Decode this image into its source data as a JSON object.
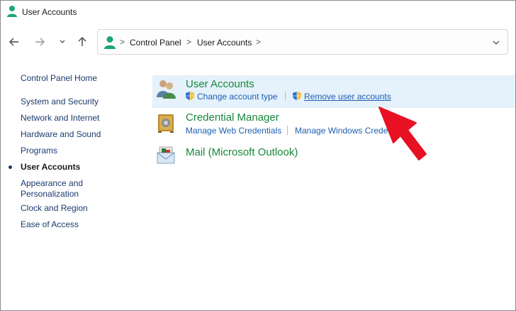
{
  "window": {
    "title": "User Accounts"
  },
  "address": {
    "crumbs": [
      "Control Panel",
      "User Accounts"
    ],
    "separator": ">"
  },
  "sidebar": {
    "home": "Control Panel Home",
    "items": [
      {
        "label": "System and Security"
      },
      {
        "label": "Network and Internet"
      },
      {
        "label": "Hardware and Sound"
      },
      {
        "label": "Programs"
      },
      {
        "label": "User Accounts",
        "active": true
      },
      {
        "label": "Appearance and"
      },
      {
        "label": "Personalization"
      },
      {
        "label": "Clock and Region"
      },
      {
        "label": "Ease of Access"
      }
    ]
  },
  "categories": [
    {
      "title": "User Accounts",
      "icon": "users-icon",
      "tasks": [
        "Change account type",
        "Remove user accounts"
      ]
    },
    {
      "title": "Credential Manager",
      "icon": "vault-icon",
      "tasks": [
        "Manage Web Credentials",
        "Manage Windows Creden"
      ]
    },
    {
      "title": "Mail (Microsoft Outlook)",
      "icon": "mail-icon",
      "tasks": []
    }
  ],
  "colors": {
    "link": "#1c5fb0",
    "category": "#16883a",
    "highlight": "#e5f1fb",
    "annotation_arrow": "#e81123"
  }
}
